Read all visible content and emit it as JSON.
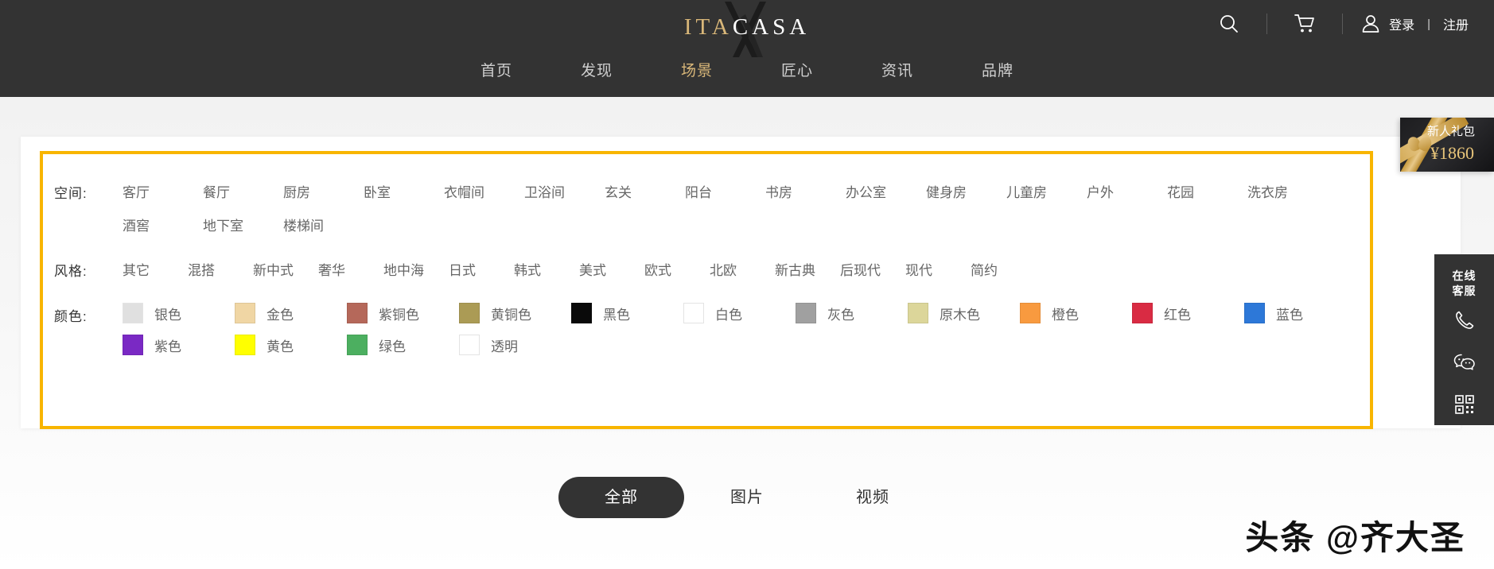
{
  "header": {
    "logo": {
      "part1": "ITA",
      "part2": "CASA",
      "mark": "x-monogram-mark"
    },
    "icons": {
      "search": "search-icon",
      "cart": "cart-icon",
      "user": "user-icon"
    },
    "account": {
      "login": "登录",
      "separator": "|",
      "register": "注册"
    },
    "nav": [
      {
        "label": "首页",
        "active": false
      },
      {
        "label": "发现",
        "active": false
      },
      {
        "label": "场景",
        "active": true
      },
      {
        "label": "匠心",
        "active": false
      },
      {
        "label": "资讯",
        "active": false
      },
      {
        "label": "品牌",
        "active": false
      }
    ],
    "colors": {
      "bar_bg": "#333333",
      "active_nav": "#d9b779",
      "logo_gold": "#d9b779"
    }
  },
  "filters": {
    "accent_border": "#f8b500",
    "space": {
      "label": "空间:",
      "items": [
        "客厅",
        "餐厅",
        "厨房",
        "卧室",
        "衣帽间",
        "卫浴间",
        "玄关",
        "阳台",
        "书房",
        "办公室",
        "健身房",
        "儿童房",
        "户外",
        "花园",
        "洗衣房",
        "酒窖",
        "地下室",
        "楼梯间"
      ]
    },
    "style": {
      "label": "风格:",
      "items": [
        "其它",
        "混搭",
        "新中式",
        "奢华",
        "地中海",
        "日式",
        "韩式",
        "美式",
        "欧式",
        "北欧",
        "新古典",
        "后现代",
        "现代",
        "简约"
      ]
    },
    "color": {
      "label": "颜色:",
      "items": [
        {
          "label": "银色",
          "hex": "#e0e0e0",
          "outline": true
        },
        {
          "label": "金色",
          "hex": "#f0d6a4",
          "outline": false
        },
        {
          "label": "紫铜色",
          "hex": "#b5685a",
          "outline": false
        },
        {
          "label": "黄铜色",
          "hex": "#ab9b55",
          "outline": false
        },
        {
          "label": "黑色",
          "hex": "#0a0a0a",
          "outline": false
        },
        {
          "label": "白色",
          "hex": "#ffffff",
          "outline": true
        },
        {
          "label": "灰色",
          "hex": "#a0a0a0",
          "outline": false
        },
        {
          "label": "原木色",
          "hex": "#dcd69a",
          "outline": false
        },
        {
          "label": "橙色",
          "hex": "#f89a3f",
          "outline": false
        },
        {
          "label": "红色",
          "hex": "#d92b43",
          "outline": false
        },
        {
          "label": "蓝色",
          "hex": "#2d78d8",
          "outline": false
        },
        {
          "label": "紫色",
          "hex": "#7a29c4",
          "outline": false
        },
        {
          "label": "黄色",
          "hex": "#ffff00",
          "outline": false
        },
        {
          "label": "绿色",
          "hex": "#4caf60",
          "outline": false
        },
        {
          "label": "透明",
          "hex": "#ffffff",
          "outline": true
        }
      ]
    }
  },
  "tabs": [
    {
      "label": "全部",
      "active": true
    },
    {
      "label": "图片",
      "active": false
    },
    {
      "label": "视频",
      "active": false
    }
  ],
  "gift_banner": {
    "title": "新人礼包",
    "price": "¥1860",
    "icon": "gift-ribbon-icon"
  },
  "service_bar": {
    "title": "在线\n客服",
    "title_line1": "在线",
    "title_line2": "客服",
    "icons": [
      "phone-icon",
      "wechat-icon",
      "qrcode-icon"
    ]
  },
  "watermark": {
    "text": "头条 @齐大圣"
  }
}
